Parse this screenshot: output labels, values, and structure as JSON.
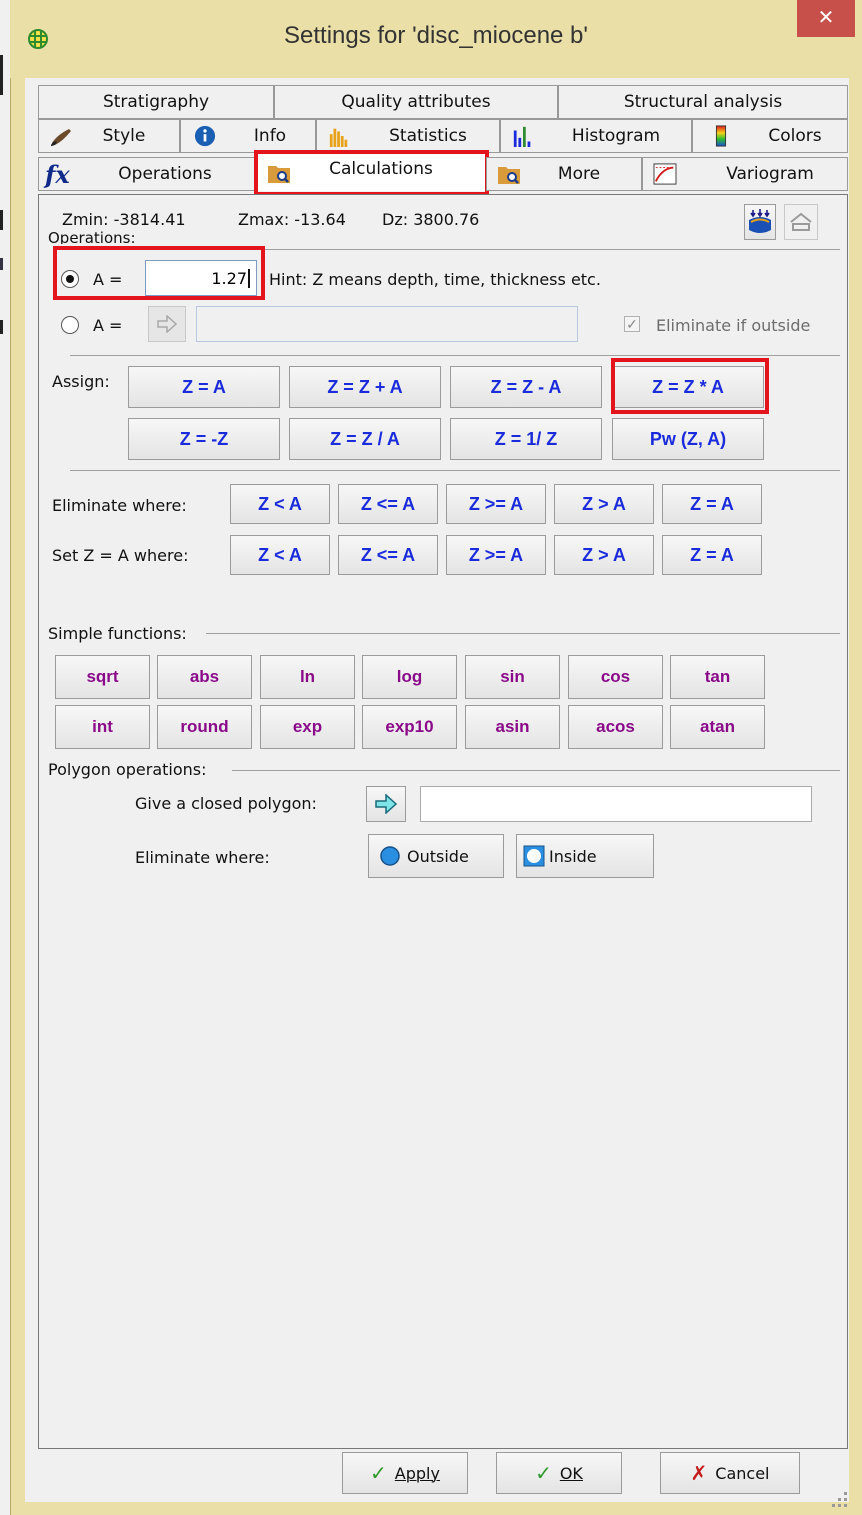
{
  "window": {
    "title": "Settings for 'disc_miocene b'",
    "close_glyph": "✕",
    "app_icon": "grid-globe-icon"
  },
  "tabs": {
    "row1": [
      {
        "label": "Stratigraphy"
      },
      {
        "label": "Quality attributes"
      },
      {
        "label": "Structural analysis"
      }
    ],
    "row2": [
      {
        "label": "Style",
        "icon": "brush-icon"
      },
      {
        "label": "Info",
        "icon": "info-icon"
      },
      {
        "label": "Statistics",
        "icon": "bar-chart-orange-icon"
      },
      {
        "label": "Histogram",
        "icon": "histogram-icon"
      },
      {
        "label": "Colors",
        "icon": "color-scale-icon"
      }
    ],
    "row3": [
      {
        "label": "Operations",
        "icon": "fx-icon"
      },
      {
        "label": "Calculations",
        "icon": "folder-search-icon",
        "active": true
      },
      {
        "label": "More",
        "icon": "folder-search-icon"
      },
      {
        "label": "Variogram",
        "icon": "variogram-icon"
      }
    ]
  },
  "stats": {
    "zmin": "Zmin: -3814.41",
    "zmax": "Zmax: -13.64",
    "dz": "Dz: 3800.76"
  },
  "operations": {
    "group_label": "Operations:",
    "a_label": "A =",
    "a_value": "1.27",
    "hint": "Hint: Z means depth, time, thickness etc.",
    "a2_label": "A =",
    "a2_value": "",
    "eliminate_if_outside": "Eliminate if outside"
  },
  "assign": {
    "label": "Assign:",
    "buttons": [
      "Z = A",
      "Z = Z + A",
      "Z = Z - A",
      "Z = Z * A",
      "Z = -Z",
      "Z = Z / A",
      "Z = 1/ Z",
      "Pw (Z, A)"
    ]
  },
  "eliminate": {
    "label": "Eliminate where:",
    "buttons": [
      "Z < A",
      "Z <= A",
      "Z >= A",
      "Z > A",
      "Z = A"
    ]
  },
  "setz": {
    "label": "Set Z = A where:",
    "buttons": [
      "Z < A",
      "Z <= A",
      "Z >= A",
      "Z > A",
      "Z = A"
    ]
  },
  "functions": {
    "label": "Simple functions:",
    "row1": [
      "sqrt",
      "abs",
      "ln",
      "log",
      "sin",
      "cos",
      "tan"
    ],
    "row2": [
      "int",
      "round",
      "exp",
      "exp10",
      "asin",
      "acos",
      "atan"
    ]
  },
  "polygon": {
    "label": "Polygon operations:",
    "give_label": "Give a closed polygon:",
    "give_value": "",
    "eliminate_label": "Eliminate where:",
    "outside": "Outside",
    "inside": "Inside"
  },
  "footer": {
    "apply": "Apply",
    "ok": "OK",
    "cancel": "Cancel"
  },
  "colors": {
    "title_bar": "#eadfa6",
    "close": "#c7504a",
    "highlight": "#e4141c",
    "assign_text": "#1a2bdc",
    "function_text": "#8a0a8a"
  }
}
